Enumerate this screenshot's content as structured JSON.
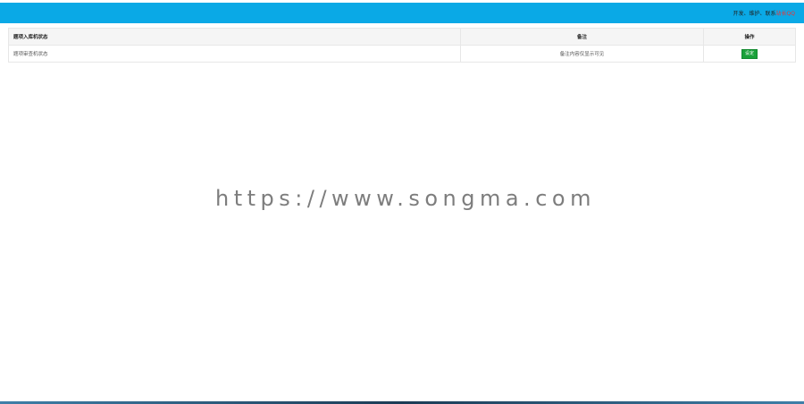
{
  "header": {
    "right_text": "开发、维护、联系",
    "qq_link": "站长QQ"
  },
  "table": {
    "headers": [
      "题项入库机状态",
      "备注",
      "操作"
    ],
    "rows": [
      {
        "status": "题项审查机状态",
        "note": "备注内容仅显示可见",
        "action": "设定"
      }
    ]
  },
  "watermark": "https://www.songma.com"
}
